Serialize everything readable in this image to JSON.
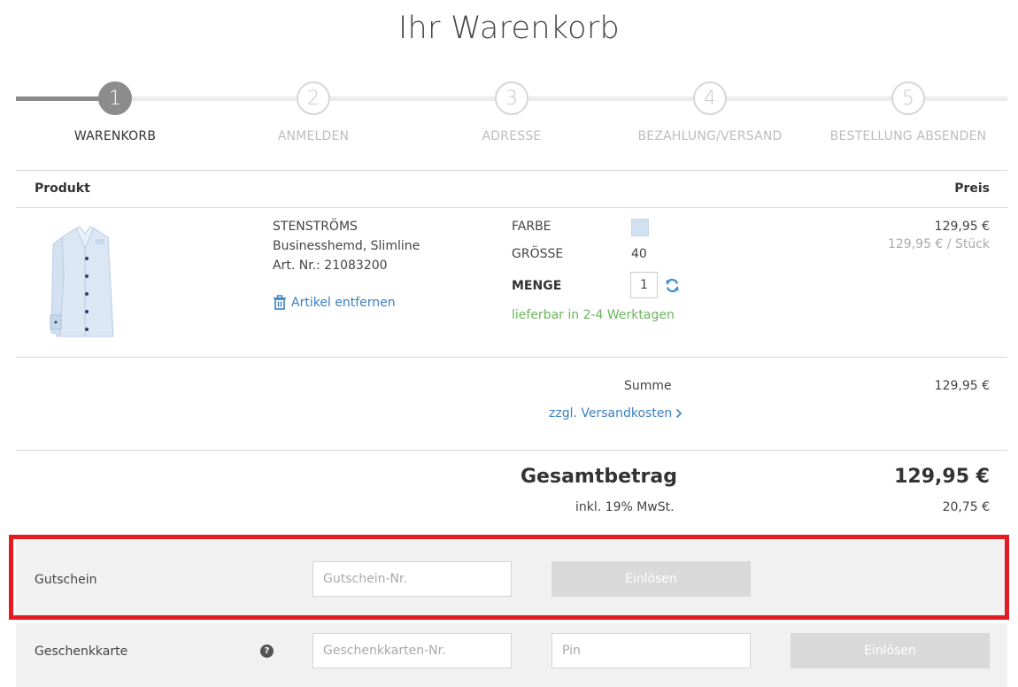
{
  "page": {
    "title": "Ihr Warenkorb"
  },
  "steps": [
    {
      "number": "1",
      "label": "WARENKORB"
    },
    {
      "number": "2",
      "label": "ANMELDEN"
    },
    {
      "number": "3",
      "label": "ADRESSE"
    },
    {
      "number": "4",
      "label": "BEZAHLUNG/VERSAND"
    },
    {
      "number": "5",
      "label": "BESTELLUNG ABSENDEN"
    }
  ],
  "table": {
    "col_product": "Produkt",
    "col_price": "Preis"
  },
  "item": {
    "brand": "STENSTRÖMS",
    "name": "Businesshemd, Slimline",
    "art_nr": "Art. Nr.: 21083200",
    "remove_label": "Artikel entfernen",
    "color_label": "FARBE",
    "color_hex": "#d2e1f2",
    "size_label": "GRÖSSE",
    "size_value": "40",
    "qty_label": "MENGE",
    "qty_value": "1",
    "availability": "lieferbar in 2-4 Werktagen",
    "price": "129,95 €",
    "unit_price": "129,95 € / Stück"
  },
  "summary": {
    "sum_label": "Summe",
    "sum_value": "129,95 €",
    "shipping_link": "zzgl. Versandkosten",
    "total_label": "Gesamtbetrag",
    "total_value": "129,95 €",
    "vat_label": "inkl. 19% MwSt.",
    "vat_value": "20,75 €"
  },
  "voucher": {
    "label": "Gutschein",
    "placeholder": "Gutschein-Nr.",
    "button": "Einlösen"
  },
  "giftcard": {
    "label": "Geschenkkarte",
    "help_icon": "?",
    "number_placeholder": "Geschenkkarten-Nr.",
    "pin_placeholder": "Pin",
    "button": "Einlösen"
  },
  "colors": {
    "accent_link": "#3a7fc1",
    "available_green": "#6bb55e",
    "highlight_red": "#e31b23"
  }
}
